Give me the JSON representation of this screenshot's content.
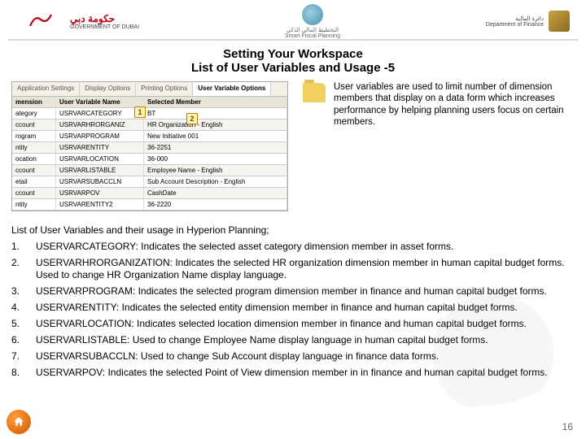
{
  "header": {
    "left": {
      "brand_ar": "حكومة دبي",
      "brand_en": "GOVERNMENT OF DUBAI"
    },
    "center": {
      "label_ar": "التخطيط المالي الذكي",
      "label_en": "Smart Fiscal Planning"
    },
    "right": {
      "label_ar": "دائرة المالية",
      "label_en": "Department of Finance"
    }
  },
  "title": {
    "line1": "Setting Your Workspace",
    "line2": "List of User Variables and Usage -5"
  },
  "screenshot": {
    "tabs": [
      "Application Settings",
      "Display Options",
      "Printing Options",
      "User Variable Options"
    ],
    "active_tab": 3,
    "columns": [
      "mension",
      "User Variable Name",
      "Selected Member"
    ],
    "rows": [
      {
        "c0": "ategory",
        "c1": "USRVARCATEGORY",
        "c2": "BT"
      },
      {
        "c0": "ccount",
        "c1": "USRVARHRORGANIZ",
        "c2": "HR Organization - English"
      },
      {
        "c0": "rogram",
        "c1": "USRVARPROGRAM",
        "c2": "New Initiative 001"
      },
      {
        "c0": "ntity",
        "c1": "USRVARENTITY",
        "c2": "36-2251"
      },
      {
        "c0": "ocation",
        "c1": "USRVARLOCATION",
        "c2": "36-000"
      },
      {
        "c0": "ccount",
        "c1": "USRVARLISTABLE",
        "c2": "Employee Name - English"
      },
      {
        "c0": "etail",
        "c1": "USRVARSUBACCLN",
        "c2": "Sub Account Description - English"
      },
      {
        "c0": "ccount",
        "c1": "USRVARPOV",
        "c2": "CashDate"
      },
      {
        "c0": "ntity",
        "c1": "USRVARENTITY2",
        "c2": "36-2220"
      }
    ],
    "callouts": {
      "one": "1",
      "two": "2"
    }
  },
  "info": {
    "text": "User variables are used to limit number of dimension members that display on a data form which increases performance by helping planning users focus on certain members."
  },
  "intro": "List of User Variables and their usage in Hyperion Planning;",
  "list": [
    {
      "n": "1.",
      "t": "USERVARCATEGORY: Indicates the selected asset category dimension member in asset forms."
    },
    {
      "n": "2.",
      "t": "USERVARHRORGANIZATION: Indicates the selected HR organization dimension member in human capital budget forms. Used to change HR Organization Name display language."
    },
    {
      "n": "3.",
      "t": "USERVARPROGRAM: Indicates the selected program dimension member in finance and human capital budget forms."
    },
    {
      "n": "4.",
      "t": "USERVARENTITY: Indicates the selected entity dimension member in finance and human capital budget forms."
    },
    {
      "n": "5.",
      "t": "USERVARLOCATION: Indicates selected location dimension member in finance and human capital budget forms."
    },
    {
      "n": "6.",
      "t": "USERVARLISTABLE: Used to change Employee Name display language in human capital budget forms."
    },
    {
      "n": "7.",
      "t": "USERVARSUBACCLN: Used to change Sub Account display language in finance data forms."
    },
    {
      "n": "8.",
      "t": "USERVARPOV: Indicates the selected Point of View dimension member in in finance and human capital budget forms."
    }
  ],
  "page_number": "16"
}
